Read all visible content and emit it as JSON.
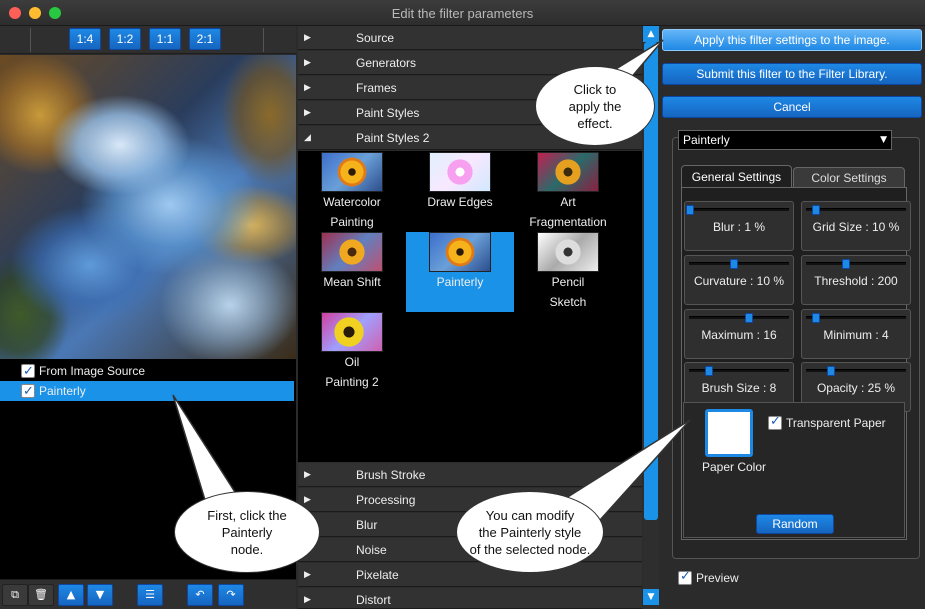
{
  "window": {
    "title": "Edit the filter parameters"
  },
  "zoom_buttons": [
    "1:4",
    "1:2",
    "1:1",
    "2:1"
  ],
  "layers": [
    {
      "label": "From Image Source",
      "checked": true,
      "selected": false
    },
    {
      "label": "Painterly",
      "checked": true,
      "selected": true
    }
  ],
  "bottom_toolbar": {
    "icons": [
      "new-layer-icon",
      "delete-icon",
      "move-up-icon",
      "move-down-icon",
      "menu-icon",
      "undo-icon",
      "redo-icon"
    ],
    "glyphs": [
      "",
      "",
      "▲",
      "▼",
      "☰",
      "↶",
      "↷"
    ]
  },
  "categories_top": [
    {
      "label": "Source",
      "expanded": false
    },
    {
      "label": "Generators",
      "expanded": false
    },
    {
      "label": "Frames",
      "expanded": false
    },
    {
      "label": "Paint Styles",
      "expanded": false
    },
    {
      "label": "Paint Styles 2",
      "expanded": true
    }
  ],
  "gallery": [
    {
      "line1": "Watercolor",
      "line2": "Painting",
      "selected": false
    },
    {
      "line1": "Draw Edges",
      "line2": "",
      "selected": false
    },
    {
      "line1": "Art",
      "line2": "Fragmentation",
      "selected": false
    },
    {
      "line1": "Mean Shift",
      "line2": "",
      "selected": false
    },
    {
      "line1": "Painterly",
      "line2": "",
      "selected": true
    },
    {
      "line1": "Pencil",
      "line2": "Sketch",
      "selected": false
    },
    {
      "line1": "Oil",
      "line2": "Painting 2",
      "selected": false
    }
  ],
  "categories_bottom": [
    {
      "label": "Brush Stroke",
      "expanded": false
    },
    {
      "label": "Processing",
      "expanded": false
    },
    {
      "label": "Blur",
      "expanded": false
    },
    {
      "label": "Noise",
      "expanded": false
    },
    {
      "label": "Pixelate",
      "expanded": false
    },
    {
      "label": "Distort",
      "expanded": false
    }
  ],
  "actions": {
    "apply": "Apply this filter settings to the image.",
    "submit": "Submit this filter to the Filter Library.",
    "cancel": "Cancel"
  },
  "filter_select": {
    "value": "Painterly"
  },
  "tabs": {
    "general": "General Settings",
    "color": "Color Settings"
  },
  "params": [
    {
      "label": "Blur : 1 %",
      "level": 0.01
    },
    {
      "label": "Grid Size : 10 %",
      "level": 0.1
    },
    {
      "label": "Curvature : 10 %",
      "level": 0.45
    },
    {
      "label": "Threshold : 200",
      "level": 0.4
    },
    {
      "label": "Maximum : 16",
      "level": 0.6
    },
    {
      "label": "Minimum : 4",
      "level": 0.1
    },
    {
      "label": "Brush Size : 8",
      "level": 0.2
    },
    {
      "label": "Opacity : 25 %",
      "level": 0.25
    }
  ],
  "paper": {
    "color_label": "Paper Color",
    "color": "#ffffff",
    "transparent_label": "Transparent Paper",
    "transparent_checked": true
  },
  "random_label": "Random",
  "preview": {
    "label": "Preview",
    "checked": true
  },
  "callouts": {
    "apply": "Click to\napply the\neffect.",
    "modify": "You can modify\nthe Painterly style\nof the selected node.",
    "first": "First, click the\nPainterly\nnode."
  },
  "colors": {
    "accent": "#1a92e8",
    "background": "#2b2b2b"
  }
}
